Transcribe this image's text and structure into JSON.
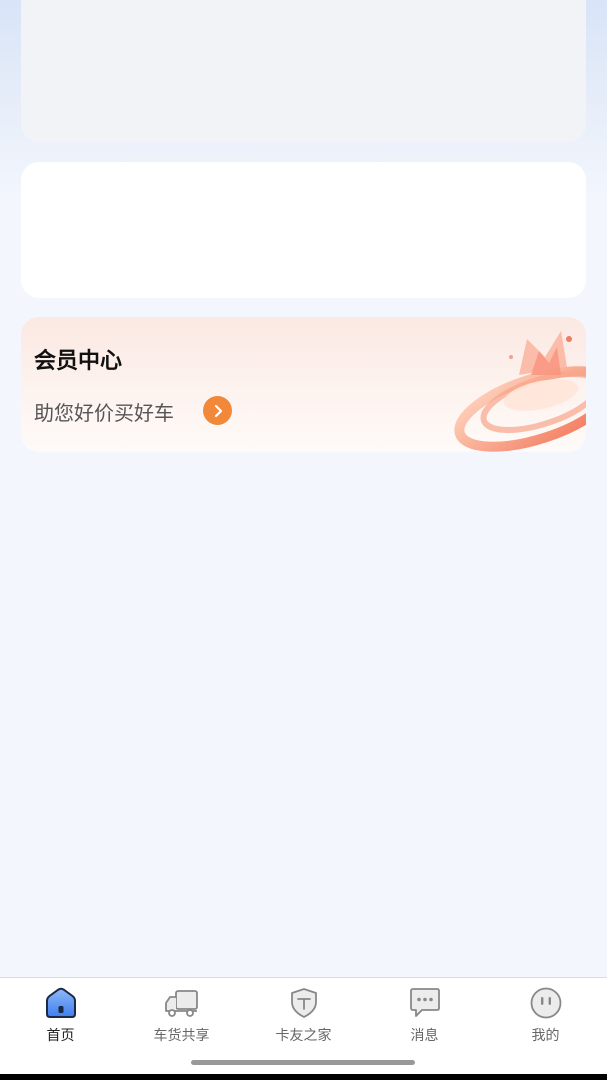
{
  "member_center": {
    "title": "会员中心",
    "subtitle": "助您好价买好车"
  },
  "tabbar": {
    "active_index": 0,
    "tabs": [
      {
        "label": "首页",
        "icon": "home-icon"
      },
      {
        "label": "车货共享",
        "icon": "truck-icon"
      },
      {
        "label": "卡友之家",
        "icon": "shield-icon"
      },
      {
        "label": "消息",
        "icon": "message-icon"
      },
      {
        "label": "我的",
        "icon": "profile-icon"
      }
    ]
  },
  "colors": {
    "accent_orange": "#f2883a",
    "page_background": "#f3f6fd",
    "tab_active_blue": "#4a8cf0"
  }
}
